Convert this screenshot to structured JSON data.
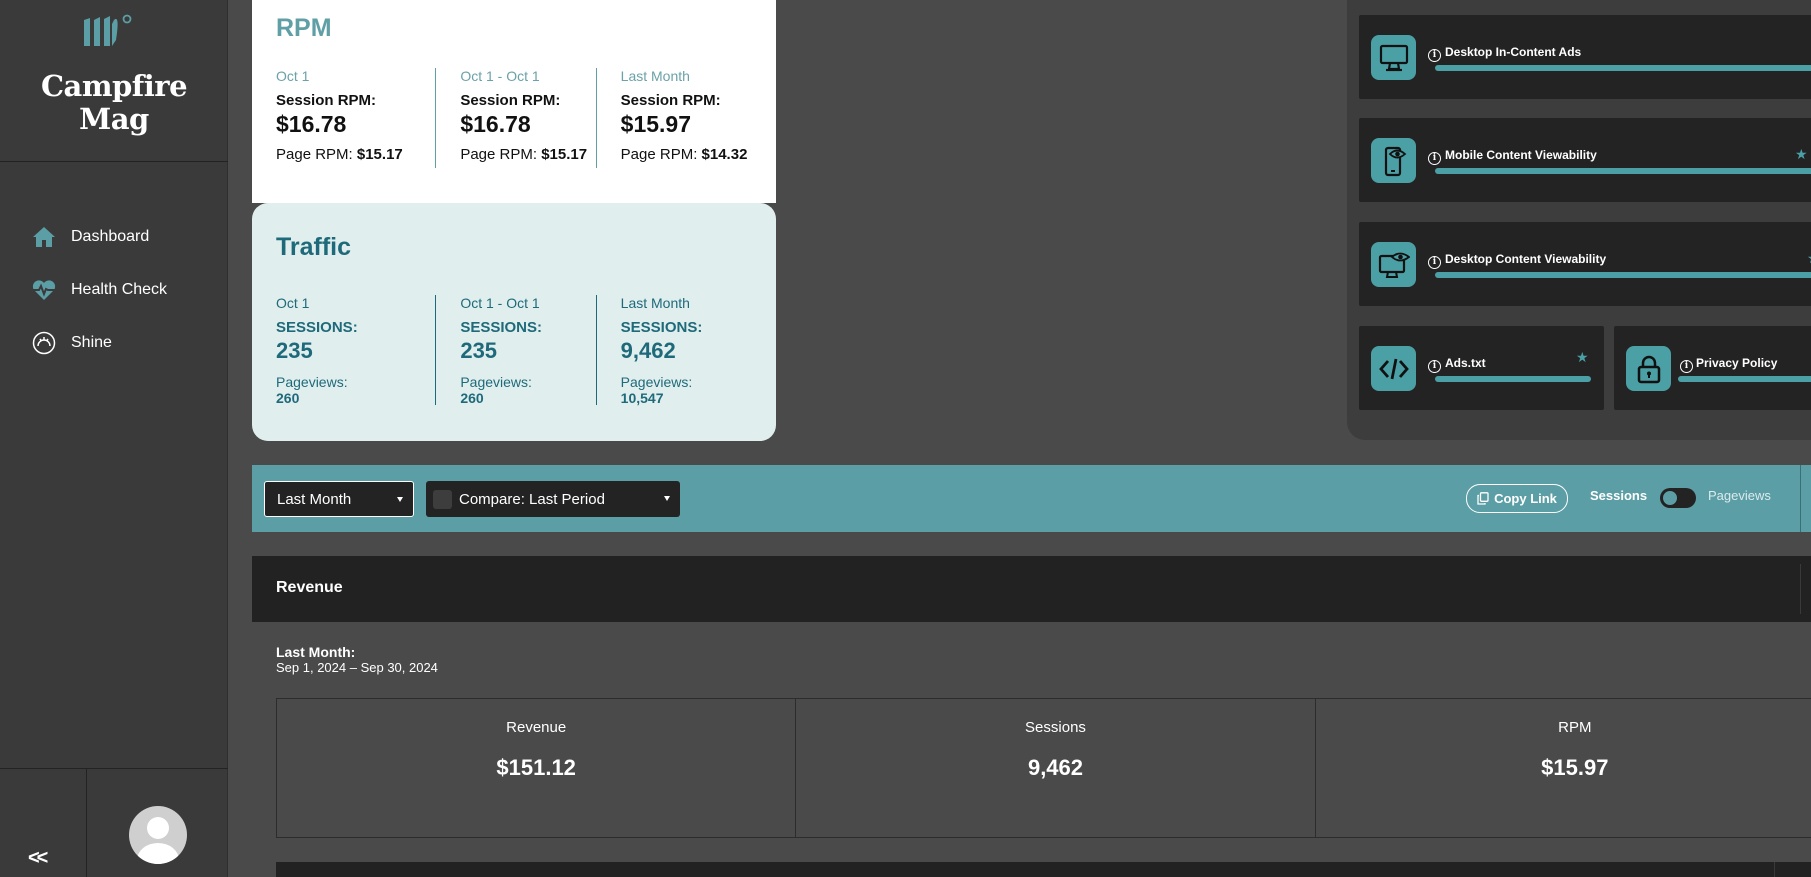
{
  "brand": {
    "name_line1": "Campfire",
    "name_line2": "Mag"
  },
  "nav": [
    {
      "label": "Dashboard",
      "icon": "home-icon"
    },
    {
      "label": "Health Check",
      "icon": "heartbeat-icon"
    },
    {
      "label": "Shine",
      "icon": "shine-icon"
    }
  ],
  "sidebar": {
    "collapse_label": "<<"
  },
  "rpm": {
    "title": "RPM",
    "columns": [
      {
        "period": "Oct 1",
        "label": "Session RPM:",
        "value": "$16.78",
        "sub_label": "Page RPM: ",
        "sub_value": "$15.17"
      },
      {
        "period": "Oct 1 - Oct 1",
        "label": "Session RPM:",
        "value": "$16.78",
        "sub_label": "Page RPM: ",
        "sub_value": "$15.17"
      },
      {
        "period": "Last Month",
        "label": "Session RPM:",
        "value": "$15.97",
        "sub_label": "Page RPM: ",
        "sub_value": "$14.32"
      }
    ]
  },
  "traffic": {
    "title": "Traffic",
    "columns": [
      {
        "period": "Oct 1",
        "label": "SESSIONS:",
        "value": "235",
        "sub_label": "Pageviews:",
        "sub_value": "260"
      },
      {
        "period": "Oct 1 - Oct 1",
        "label": "SESSIONS:",
        "value": "235",
        "sub_label": "Pageviews:",
        "sub_value": "260"
      },
      {
        "period": "Last Month",
        "label": "SESSIONS:",
        "value": "9,462",
        "sub_label": "Pageviews:",
        "sub_value": "10,547"
      }
    ]
  },
  "health": [
    {
      "label": "Desktop In-Content Ads",
      "icon": "desktop-icon"
    },
    {
      "label": "Mobile Content Viewability",
      "icon": "mobile-eye-icon"
    },
    {
      "label": "Desktop Content Viewability",
      "icon": "desktop-eye-icon"
    },
    {
      "label": "Ads.txt",
      "icon": "code-icon"
    },
    {
      "label": "Privacy Policy",
      "icon": "lock-icon"
    }
  ],
  "toolbar": {
    "period_select": "Last Month",
    "compare_select": "Compare: Last Period",
    "copy_link": "Copy Link",
    "toggle_left": "Sessions",
    "toggle_right": "Pageviews"
  },
  "revenue": {
    "title": "Revenue",
    "period_label": "Last Month:",
    "period_range": "Sep 1, 2024 – Sep 30, 2024",
    "stats": [
      {
        "label": "Revenue",
        "value": "$151.12"
      },
      {
        "label": "Sessions",
        "value": "9,462"
      },
      {
        "label": "RPM",
        "value": "$15.97"
      }
    ]
  },
  "colors": {
    "accent": "#5c9ea6",
    "teal_dark": "#1f6a7a",
    "sidebar": "#3a3a3a",
    "panel": "#232323"
  }
}
